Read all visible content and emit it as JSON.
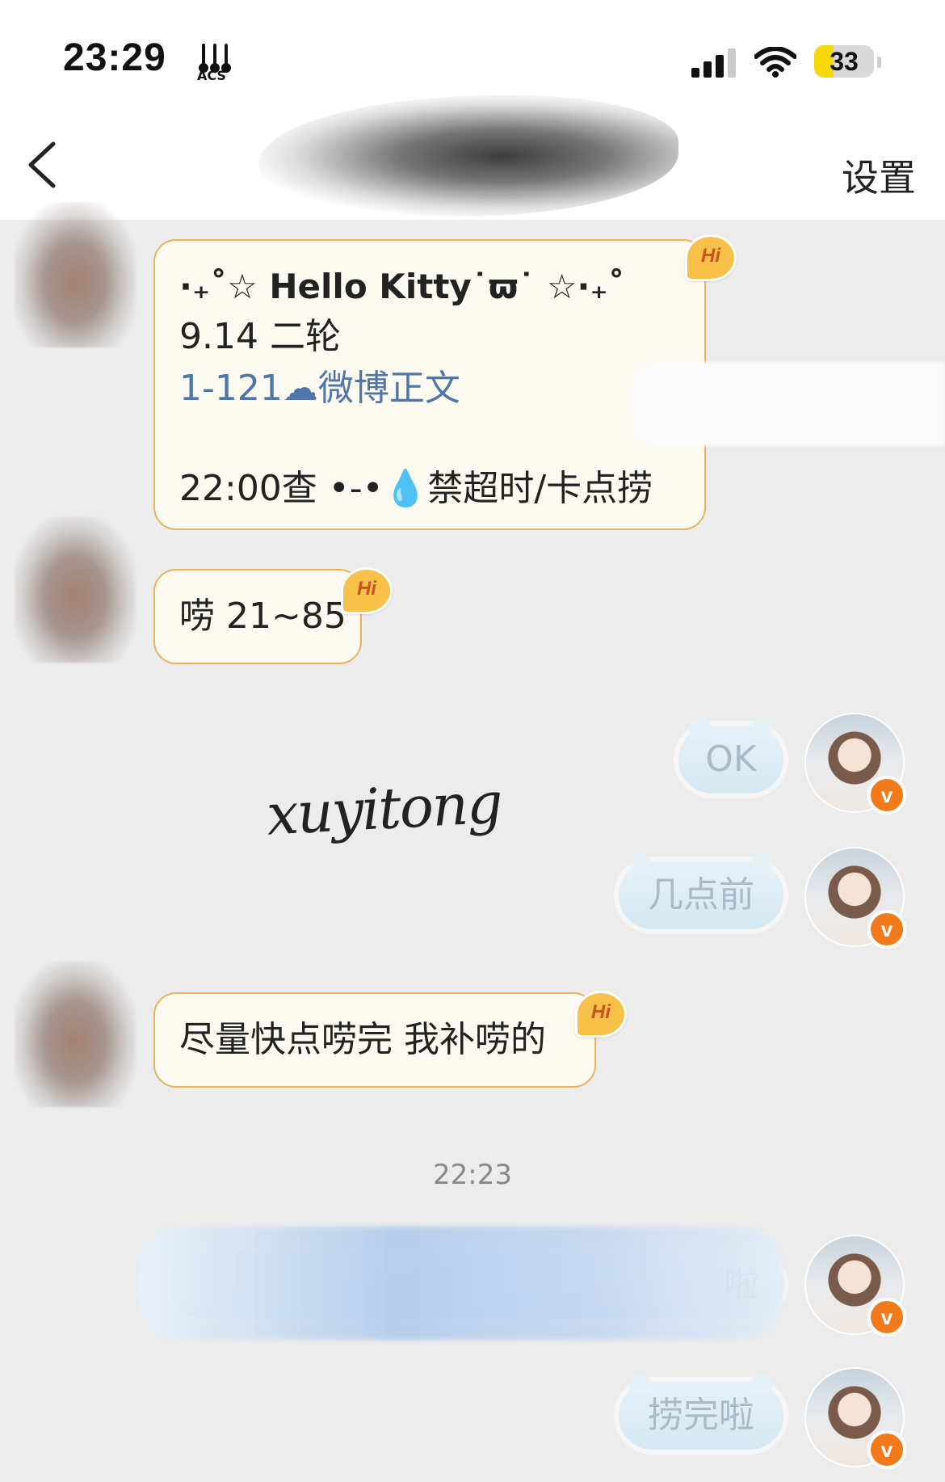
{
  "status_bar": {
    "time": "23:29",
    "battery": "33",
    "battery_fraction": 0.33,
    "signal_bars": 3
  },
  "header": {
    "back_icon": "chevron-left-icon",
    "settings_label": "设置"
  },
  "messages": [
    {
      "side": "incoming",
      "badge": "Hi",
      "lines": [
        "·₊˚☆ Hello Kitty˙ϖ˙ ☆·₊˚",
        "9.14 二轮",
        "1-121☁微博正文",
        "",
        "22:00查 •-•💧禁超时/卡点捞"
      ]
    },
    {
      "side": "incoming",
      "badge": "Hi",
      "text": "唠 21~85"
    },
    {
      "side": "outgoing",
      "text": "OK"
    },
    {
      "side": "outgoing",
      "text": "几点前"
    },
    {
      "side": "incoming",
      "badge": "Hi",
      "text": "尽量快点唠完 我补唠的"
    },
    {
      "side": "outgoing",
      "text": "啦"
    },
    {
      "side": "outgoing",
      "text": "捞完啦"
    }
  ],
  "timestamp": "22:23",
  "watermark": "xuyitong",
  "colors": {
    "incoming_bubble_bg": "#fdfaf1",
    "incoming_bubble_border": "#e9b25c",
    "link_text": "#4f76a8",
    "outgoing_bubble_bg": "#dcecf6",
    "vip_badge": "#f27a1b",
    "background": "#ececec"
  }
}
